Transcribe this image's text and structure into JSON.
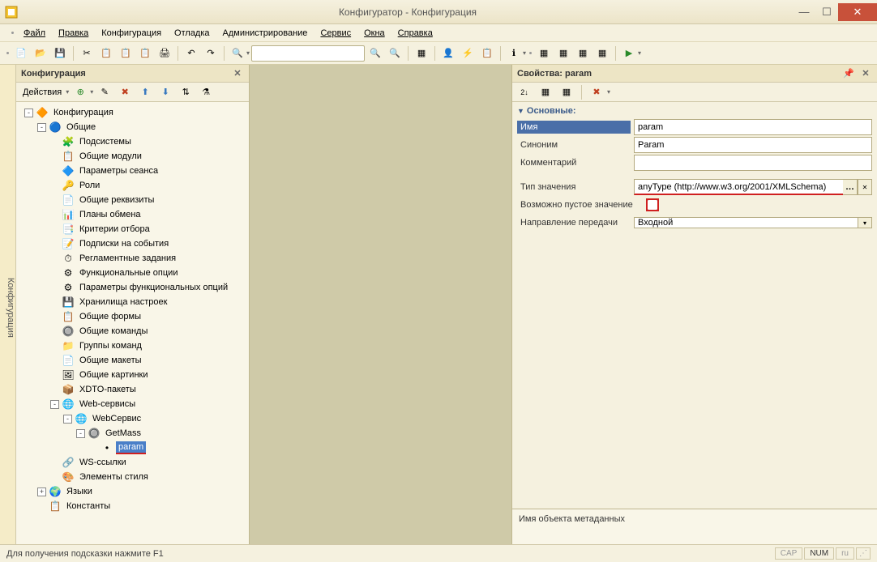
{
  "window": {
    "title": "Конфигуратор - Конфигурация"
  },
  "menu": [
    "Файл",
    "Правка",
    "Конфигурация",
    "Отладка",
    "Администрирование",
    "Сервис",
    "Окна",
    "Справка"
  ],
  "sidebar_tab": "Конфигурация",
  "left_panel": {
    "title": "Конфигурация",
    "actions": "Действия"
  },
  "tree": [
    {
      "d": 0,
      "exp": "-",
      "icon": "🔶",
      "label": "Конфигурация"
    },
    {
      "d": 1,
      "exp": "-",
      "icon": "🔵",
      "label": "Общие"
    },
    {
      "d": 2,
      "exp": "",
      "icon": "🧩",
      "label": "Подсистемы"
    },
    {
      "d": 2,
      "exp": "",
      "icon": "📋",
      "label": "Общие модули"
    },
    {
      "d": 2,
      "exp": "",
      "icon": "🔷",
      "label": "Параметры сеанса"
    },
    {
      "d": 2,
      "exp": "",
      "icon": "🔑",
      "label": "Роли"
    },
    {
      "d": 2,
      "exp": "",
      "icon": "📄",
      "label": "Общие реквизиты"
    },
    {
      "d": 2,
      "exp": "",
      "icon": "📊",
      "label": "Планы обмена"
    },
    {
      "d": 2,
      "exp": "",
      "icon": "📑",
      "label": "Критерии отбора"
    },
    {
      "d": 2,
      "exp": "",
      "icon": "📝",
      "label": "Подписки на события"
    },
    {
      "d": 2,
      "exp": "",
      "icon": "⏱",
      "label": "Регламентные задания"
    },
    {
      "d": 2,
      "exp": "",
      "icon": "⚙",
      "label": "Функциональные опции"
    },
    {
      "d": 2,
      "exp": "",
      "icon": "⚙",
      "label": "Параметры функциональных опций"
    },
    {
      "d": 2,
      "exp": "",
      "icon": "💾",
      "label": "Хранилища настроек"
    },
    {
      "d": 2,
      "exp": "",
      "icon": "📋",
      "label": "Общие формы"
    },
    {
      "d": 2,
      "exp": "",
      "icon": "🔘",
      "label": "Общие команды"
    },
    {
      "d": 2,
      "exp": "",
      "icon": "📁",
      "label": "Группы команд"
    },
    {
      "d": 2,
      "exp": "",
      "icon": "📄",
      "label": "Общие макеты"
    },
    {
      "d": 2,
      "exp": "",
      "icon": "🖼",
      "label": "Общие картинки"
    },
    {
      "d": 2,
      "exp": "",
      "icon": "📦",
      "label": "XDTO-пакеты"
    },
    {
      "d": 2,
      "exp": "-",
      "icon": "🌐",
      "label": "Web-сервисы"
    },
    {
      "d": 3,
      "exp": "-",
      "icon": "🌐",
      "label": "WebСервис"
    },
    {
      "d": 4,
      "exp": "-",
      "icon": "🔘",
      "label": "GetMass"
    },
    {
      "d": 5,
      "exp": "",
      "icon": "•",
      "label": "param",
      "selected": true,
      "ul": true
    },
    {
      "d": 2,
      "exp": "",
      "icon": "🔗",
      "label": "WS-ссылки"
    },
    {
      "d": 2,
      "exp": "",
      "icon": "🎨",
      "label": "Элементы стиля"
    },
    {
      "d": 1,
      "exp": "+",
      "icon": "🌍",
      "label": "Языки"
    },
    {
      "d": 1,
      "exp": "",
      "icon": "📋",
      "label": "Константы"
    }
  ],
  "right_panel": {
    "title": "Свойства: param",
    "section": "Основные:",
    "rows": {
      "name_label": "Имя",
      "name_value": "param",
      "synonym_label": "Синоним",
      "synonym_value": "Param",
      "comment_label": "Комментарий",
      "comment_value": "",
      "type_label": "Тип значения",
      "type_value": "anyType (http://www.w3.org/2001/XMLSchema)",
      "nullable_label": "Возможно пустое значение",
      "direction_label": "Направление передачи",
      "direction_value": "Входной"
    },
    "hint": "Имя объекта метаданных"
  },
  "statusbar": {
    "hint": "Для получения подсказки нажмите F1",
    "cap": "CAP",
    "num": "NUM",
    "lang": "ru"
  }
}
